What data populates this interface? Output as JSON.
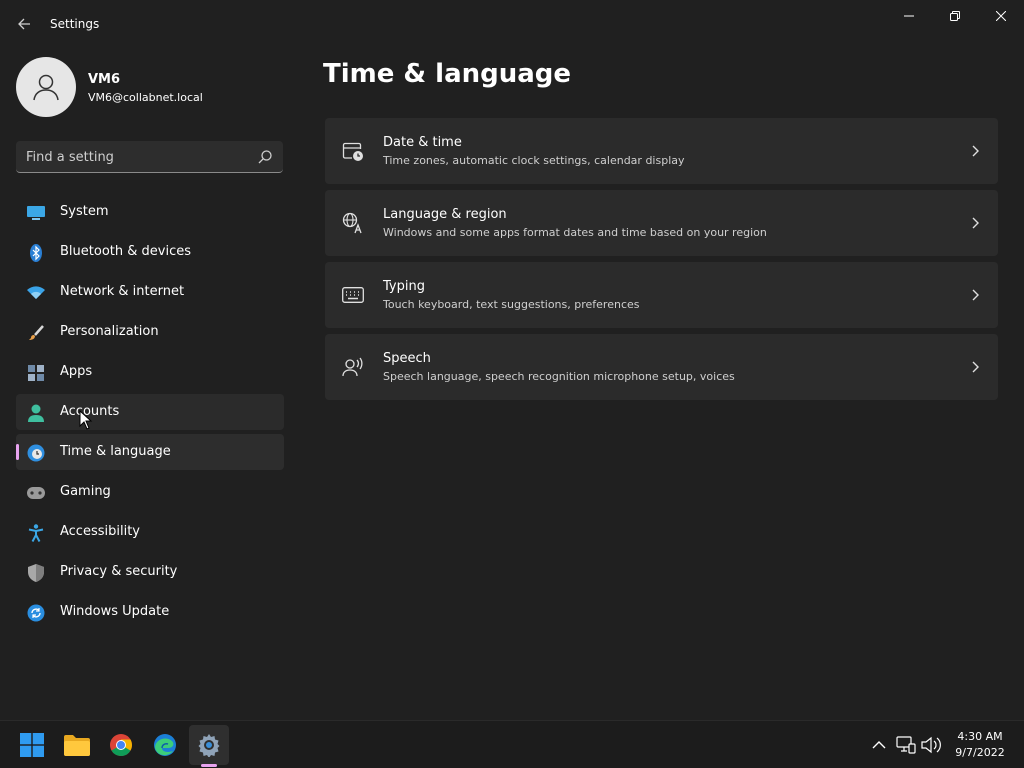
{
  "window": {
    "title": "Settings",
    "controls": [
      "minimize",
      "restore",
      "close"
    ]
  },
  "profile": {
    "name": "VM6",
    "email": "VM6@collabnet.local"
  },
  "search": {
    "placeholder": "Find a setting",
    "value": ""
  },
  "sidebar": {
    "items": [
      {
        "label": "System",
        "icon": "monitor-icon"
      },
      {
        "label": "Bluetooth & devices",
        "icon": "bluetooth-icon"
      },
      {
        "label": "Network & internet",
        "icon": "wifi-icon"
      },
      {
        "label": "Personalization",
        "icon": "brush-icon"
      },
      {
        "label": "Apps",
        "icon": "apps-icon"
      },
      {
        "label": "Accounts",
        "icon": "person-icon"
      },
      {
        "label": "Time & language",
        "icon": "globe-clock-icon"
      },
      {
        "label": "Gaming",
        "icon": "gamepad-icon"
      },
      {
        "label": "Accessibility",
        "icon": "accessibility-icon"
      },
      {
        "label": "Privacy & security",
        "icon": "shield-icon"
      },
      {
        "label": "Windows Update",
        "icon": "update-icon"
      }
    ],
    "selected": "Time & language",
    "hovered": "Accounts"
  },
  "main": {
    "title": "Time & language",
    "cards": [
      {
        "title": "Date & time",
        "description": "Time zones, automatic clock settings, calendar display",
        "icon": "calendar-clock-icon"
      },
      {
        "title": "Language & region",
        "description": "Windows and some apps format dates and time based on your region",
        "icon": "language-icon"
      },
      {
        "title": "Typing",
        "description": "Touch keyboard, text suggestions, preferences",
        "icon": "keyboard-icon"
      },
      {
        "title": "Speech",
        "description": "Speech language, speech recognition microphone setup, voices",
        "icon": "speech-icon"
      }
    ]
  },
  "taskbar": {
    "apps": [
      "start-icon",
      "file-explorer-icon",
      "chrome-icon",
      "edge-icon",
      "settings-icon"
    ],
    "active_app": "settings-icon",
    "clock": {
      "time": "4:30 AM",
      "date": "9/7/2022"
    }
  },
  "colors": {
    "background": "#202020",
    "card": "#2b2b2b",
    "accent": "#e8a3f0"
  }
}
